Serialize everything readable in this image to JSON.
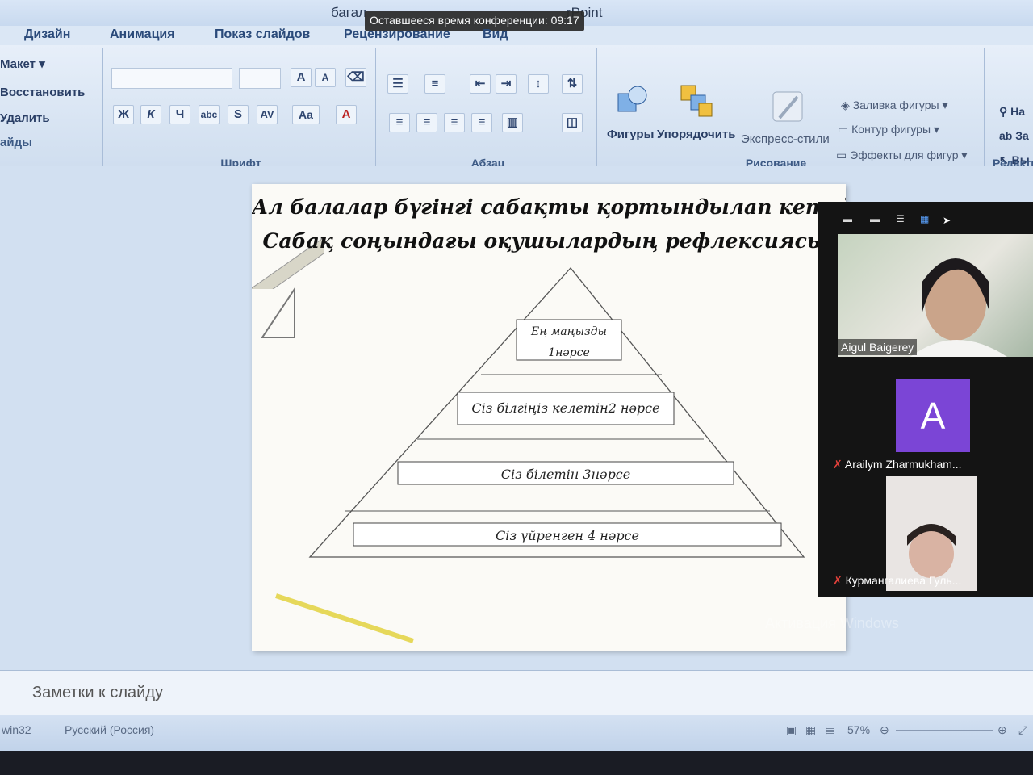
{
  "window": {
    "title": "багал",
    "title_suffix": "rPoint",
    "conference_timer": "Оставшееся время конференции: 09:17"
  },
  "ribbon_tabs": [
    "Дизайн",
    "Анимация",
    "Показ слайдов",
    "Рецензирование",
    "Вид"
  ],
  "slides_group": {
    "layout": "Макет",
    "reset": "Восстановить",
    "delete": "Удалить",
    "label": "айды"
  },
  "font_group": {
    "label": "Шрифт",
    "grow": "A",
    "shrink": "A",
    "bold": "Ж",
    "italic": "К",
    "underline": "Ч",
    "strike": "abc",
    "shadow": "S",
    "spacing": "AV",
    "case": "Aa",
    "color": "A"
  },
  "paragraph_group": {
    "label": "Абзац"
  },
  "drawing_group": {
    "label": "Рисование",
    "shapes": "Фигуры",
    "arrange": "Упорядочить",
    "quick_styles": "Экспресс-стили",
    "shape_fill": "Заливка фигуры",
    "shape_outline": "Контур фигуры",
    "shape_effects": "Эффекты для фигур"
  },
  "editing_group": {
    "label": "Редакти",
    "find": "На",
    "replace": "За",
    "select": "Вы"
  },
  "slide": {
    "title_line1": "Ал балалар бүгінгі сабақты қортындылап кетейік",
    "title_line2": "Сабақ соңындағы оқушылардың рефлексиясы:",
    "levels": [
      {
        "line1": "Ең маңызды",
        "line2": "1нәрсе"
      },
      {
        "line1": "Сіз білгіңіз келетін2 нәрсе"
      },
      {
        "line1": "Сіз білетін 3нәрсе"
      },
      {
        "line1": "Сіз үйренген 4 нәрсе"
      }
    ]
  },
  "notes": {
    "placeholder": "Заметки к слайду"
  },
  "status": {
    "left": "win32",
    "language": "Русский (Россия)",
    "zoom": "57%"
  },
  "video": {
    "participants": [
      {
        "name": "Aigul Baigerey",
        "type": "video"
      },
      {
        "name": "Arailym Zharmukham...",
        "type": "avatar",
        "initial": "A",
        "avatar_color": "#7b45d6",
        "muted": true
      },
      {
        "name": "Курмангалиева Гуль...",
        "type": "video",
        "muted": true
      }
    ]
  },
  "watermark": "Активация Windows"
}
